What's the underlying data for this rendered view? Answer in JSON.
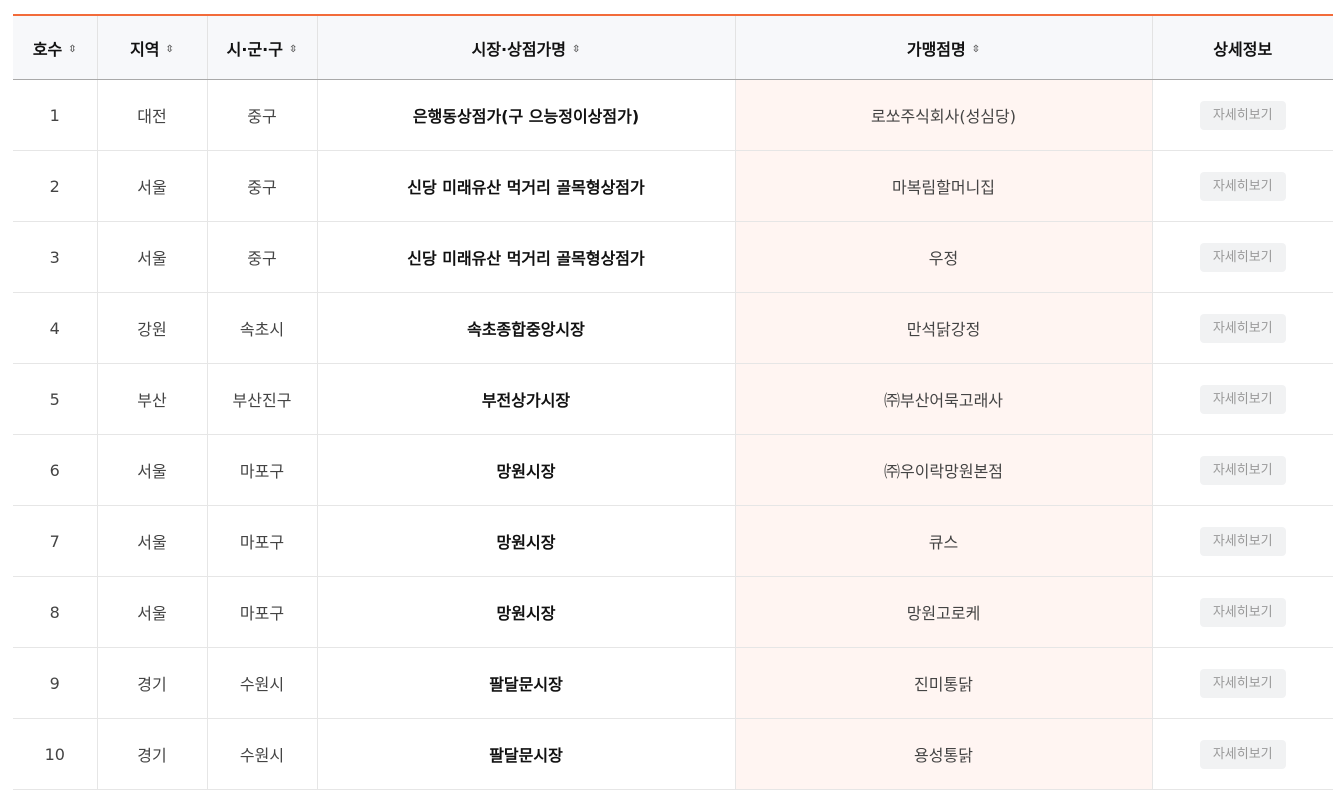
{
  "table": {
    "headers": {
      "no": "호수",
      "region": "지역",
      "district": "시·군·구",
      "market": "시장·상점가명",
      "store": "가맹점명",
      "detail": "상세정보"
    },
    "sort_icon": "⇳",
    "detail_label": "자세히보기",
    "rows": [
      {
        "no": "1",
        "region": "대전",
        "district": "중구",
        "market": "은행동상점가(구 으능정이상점가)",
        "store": "로쏘주식회사(성심당)"
      },
      {
        "no": "2",
        "region": "서울",
        "district": "중구",
        "market": "신당 미래유산 먹거리 골목형상점가",
        "store": "마복림할머니집"
      },
      {
        "no": "3",
        "region": "서울",
        "district": "중구",
        "market": "신당 미래유산 먹거리 골목형상점가",
        "store": "우정"
      },
      {
        "no": "4",
        "region": "강원",
        "district": "속초시",
        "market": "속초종합중앙시장",
        "store": "만석닭강정"
      },
      {
        "no": "5",
        "region": "부산",
        "district": "부산진구",
        "market": "부전상가시장",
        "store": "㈜부산어묵고래사"
      },
      {
        "no": "6",
        "region": "서울",
        "district": "마포구",
        "market": "망원시장",
        "store": "㈜우이락망원본점"
      },
      {
        "no": "7",
        "region": "서울",
        "district": "마포구",
        "market": "망원시장",
        "store": "큐스"
      },
      {
        "no": "8",
        "region": "서울",
        "district": "마포구",
        "market": "망원시장",
        "store": "망원고로케"
      },
      {
        "no": "9",
        "region": "경기",
        "district": "수원시",
        "market": "팔달문시장",
        "store": "진미통닭"
      },
      {
        "no": "10",
        "region": "경기",
        "district": "수원시",
        "market": "팔달문시장",
        "store": "용성통닭"
      }
    ]
  },
  "colors": {
    "accent": "#f26b3a",
    "header_bg": "#f7f8fa",
    "store_bg": "#fff5f2"
  }
}
